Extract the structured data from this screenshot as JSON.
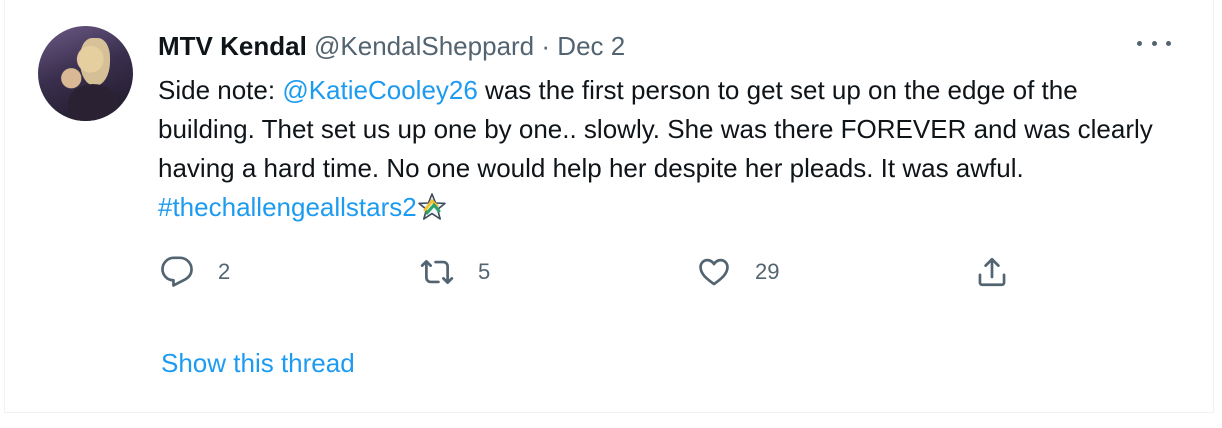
{
  "tweet": {
    "author_name": "MTV Kendal",
    "author_handle": "@KendalSheppard",
    "separator": "·",
    "date": "Dec 2",
    "text_parts": {
      "p1": "Side note: ",
      "mention": "@KatieCooley26",
      "p2": " was the first person to get set up on the edge of the building. Thet set us up one by one.. slowly. She was there FOREVER and was clearly having a hard time. No one would help her despite her pleads. It was awful. ",
      "hashtag": "#thechallengeallstars2"
    },
    "hashtag_emoji": "star-emoji",
    "reply_count": "2",
    "retweet_count": "5",
    "like_count": "29",
    "show_thread_label": "Show this thread"
  },
  "icons": {
    "more": "more-horizontal-icon",
    "reply": "reply-icon",
    "retweet": "retweet-icon",
    "like": "heart-icon",
    "share": "share-icon"
  },
  "colors": {
    "text": "#0f1419",
    "secondary": "#536471",
    "link": "#1d9bf0"
  }
}
